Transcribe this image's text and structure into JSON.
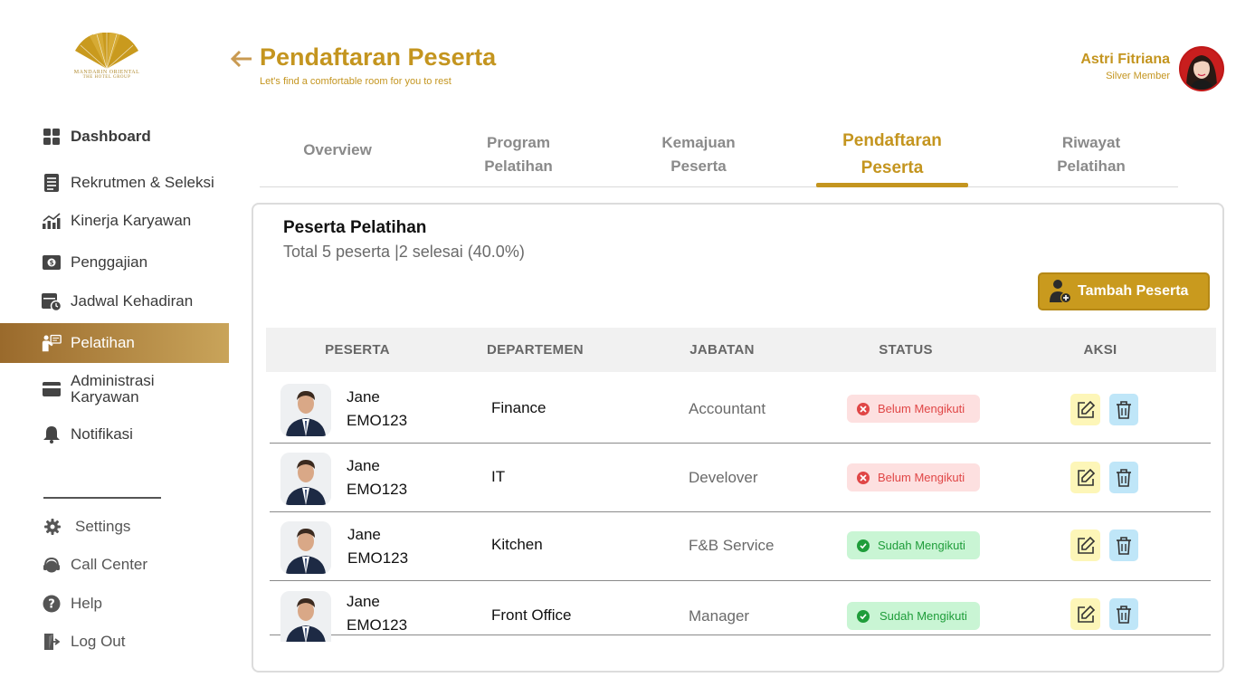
{
  "brand": {
    "line1": "MANDARIN ORIENTAL",
    "line2": "THE HOTEL GROUP",
    "color": "#b08a2e"
  },
  "sidebar": {
    "items": [
      {
        "label": "Dashboard",
        "icon": "dashboard-icon"
      },
      {
        "label": "Rekrutmen & Seleksi",
        "icon": "document-icon"
      },
      {
        "label": "Kinerja Karyawan",
        "icon": "chart-icon"
      },
      {
        "label": "Penggajian",
        "icon": "payroll-icon"
      },
      {
        "label": "Jadwal Kehadiran",
        "icon": "calendar-clock-icon"
      },
      {
        "label": "Pelatihan",
        "icon": "training-icon",
        "active": true
      },
      {
        "label": "Administrasi Karyawan",
        "icon": "card-icon"
      },
      {
        "label": "Notifikasi",
        "icon": "bell-icon"
      }
    ],
    "bottom_items": [
      {
        "label": "Settings",
        "icon": "gear-icon"
      },
      {
        "label": "Call Center",
        "icon": "headset-icon"
      },
      {
        "label": "Help",
        "icon": "help-icon"
      },
      {
        "label": "Log Out",
        "icon": "logout-icon"
      }
    ]
  },
  "header": {
    "title": "Pendaftaran Peserta",
    "subtitle": "Let's find a comfortable room for you to rest",
    "user_name": "Astri Fitriana",
    "user_tier": "Silver Member"
  },
  "tabs": [
    {
      "line1": "Overview",
      "line2": ""
    },
    {
      "line1": "Program",
      "line2": "Pelatihan"
    },
    {
      "line1": "Kemajuan",
      "line2": "Peserta"
    },
    {
      "line1": "Pendaftaran",
      "line2": "Peserta",
      "active": true
    },
    {
      "line1": "Riwayat",
      "line2": "Pelatihan"
    }
  ],
  "card": {
    "title": "Peserta Pelatihan",
    "summary": "Total 5 peserta |2 selesai (40.0%)",
    "add_button": "Tambah Peserta"
  },
  "table": {
    "headers": [
      "PESERTA",
      "DEPARTEMEN",
      "JABATAN",
      "STATUS",
      "AKSI"
    ],
    "rows": [
      {
        "name": "Jane",
        "id": "EMO123",
        "department": "Finance",
        "position": "Accountant",
        "status": "Belum Mengikuti",
        "done": false
      },
      {
        "name": "Jane",
        "id": "EMO123",
        "department": "IT",
        "position": "Develover",
        "status": "Belum Mengikuti",
        "done": false
      },
      {
        "name": "Jane",
        "id": "EMO123",
        "department": "Kitchen",
        "position": "F&B Service",
        "status": "Sudah Mengikuti",
        "done": true
      },
      {
        "name": "Jane",
        "id": "EMO123",
        "department": "Front Office",
        "position": "Manager",
        "status": "Sudah Mengikuti",
        "done": true
      }
    ]
  },
  "colors": {
    "accent": "#c4951f",
    "active_gradient_start": "#9a6a2c",
    "active_gradient_end": "#c9a45a",
    "status_pending": "#e04646",
    "status_done": "#1f9d3a"
  }
}
